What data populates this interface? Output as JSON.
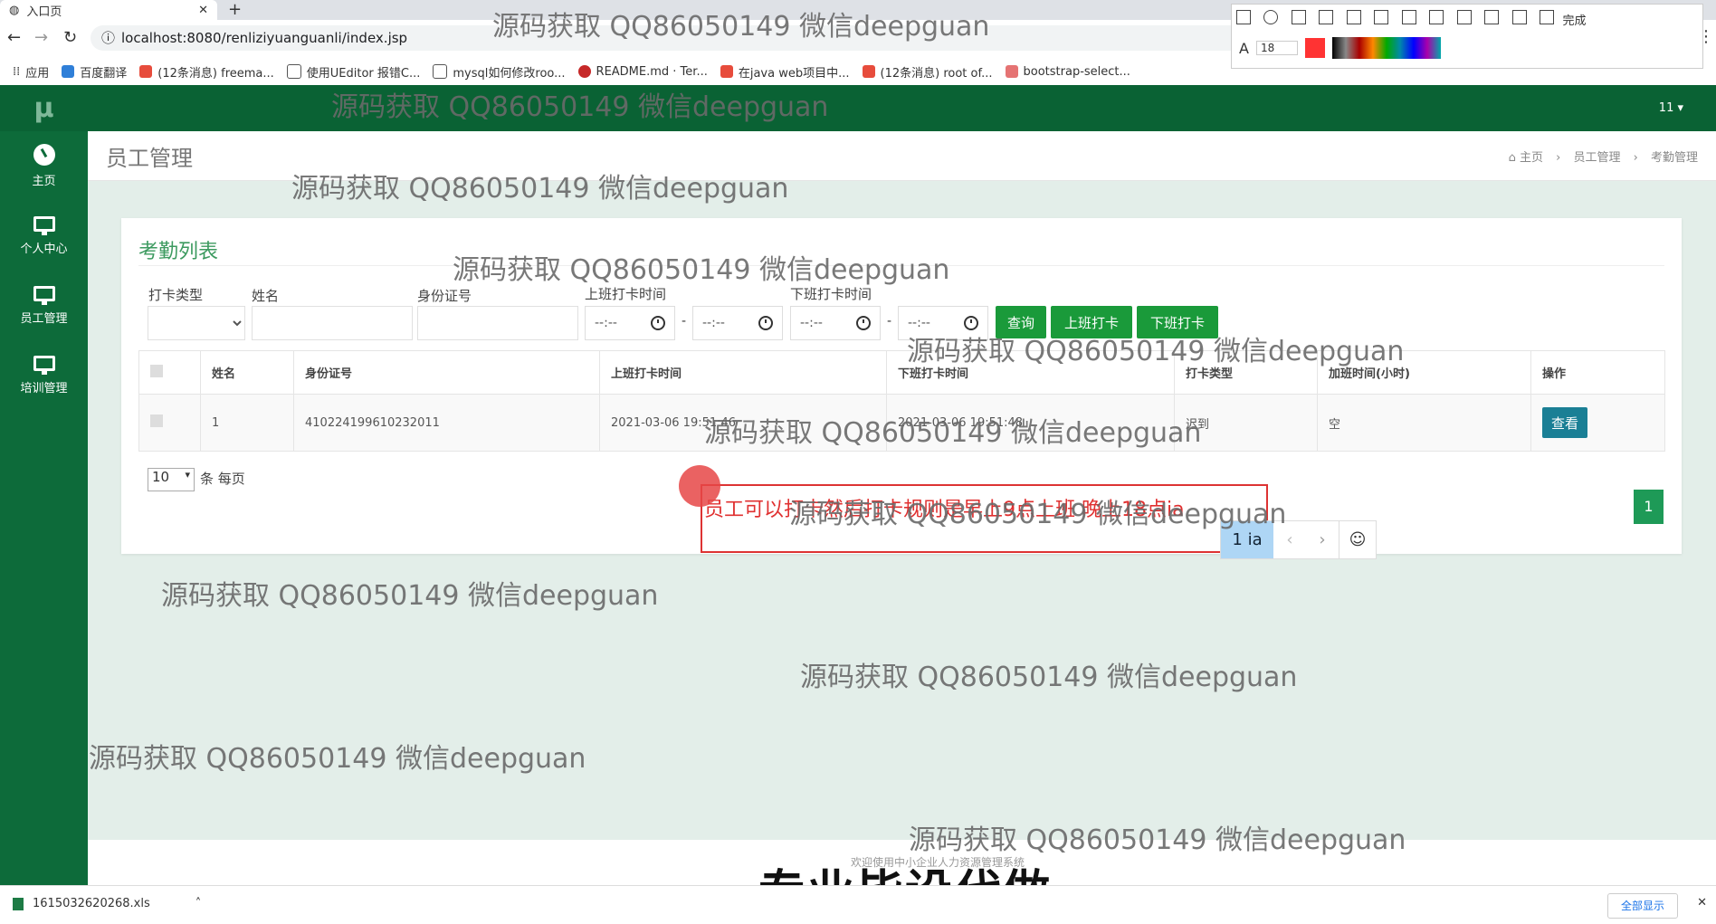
{
  "browser": {
    "tab_title": "入口页",
    "url": "localhost:8080/renliziyuanguanli/index.jsp",
    "bookmarks": [
      "应用",
      "百度翻译",
      "(12条消息) freema...",
      "使用UEditor 报错C...",
      "mysql如何修改roo...",
      "README.md · Ter...",
      "在java web项目中...",
      "(12条消息) root of...",
      "bootstrap-select..."
    ]
  },
  "snip_tool": {
    "font_size": "18",
    "done_label": "完成"
  },
  "app": {
    "logo": "μ",
    "user_menu": "11 ▾"
  },
  "sidebar": {
    "items": [
      {
        "label": "主页",
        "icon": "dashboard-icon"
      },
      {
        "label": "个人中心",
        "icon": "monitor-icon"
      },
      {
        "label": "员工管理",
        "icon": "monitor-icon"
      },
      {
        "label": "培训管理",
        "icon": "monitor-icon"
      }
    ]
  },
  "page": {
    "title": "员工管理",
    "breadcrumb": [
      "主页",
      "员工管理",
      "考勤管理"
    ]
  },
  "panel": {
    "title": "考勤列表",
    "filters": {
      "type_label": "打卡类型",
      "name_label": "姓名",
      "id_label": "身份证号",
      "checkin_label": "上班打卡时间",
      "checkout_label": "下班打卡时间",
      "time_placeholder": "--:--",
      "range_sep": "-"
    },
    "buttons": {
      "query": "查询",
      "checkin": "上班打卡",
      "checkout": "下班打卡"
    }
  },
  "table": {
    "headers": [
      "姓名",
      "身份证号",
      "上班打卡时间",
      "下班打卡时间",
      "打卡类型",
      "加班时间(小时)",
      "操作"
    ],
    "rows": [
      {
        "name": "1",
        "id": "410224199610232011",
        "checkin": "2021-03-06 19:51:46",
        "checkout": "2021-03-06 19:51:48",
        "type": "迟到",
        "overtime": "空",
        "action": "查看"
      }
    ]
  },
  "pagination": {
    "page_size": "10",
    "page_size_label": "条 每页",
    "current_page": "1"
  },
  "annotation": {
    "text": "员工可以打卡然后打卡规则是早上9点上班 晚上18点ia",
    "ime_candidate": "1 ia",
    "ime_prev": "‹",
    "ime_next": "›",
    "ime_emoji": "☺"
  },
  "footer": {
    "text": "欢迎使用中小企业人力资源管理系统",
    "slogan": "专业毕设代做"
  },
  "download": {
    "file": "1615032620268.xls",
    "show_all": "全部显示"
  },
  "watermark": "源码获取 QQ86050149 微信deepguan"
}
